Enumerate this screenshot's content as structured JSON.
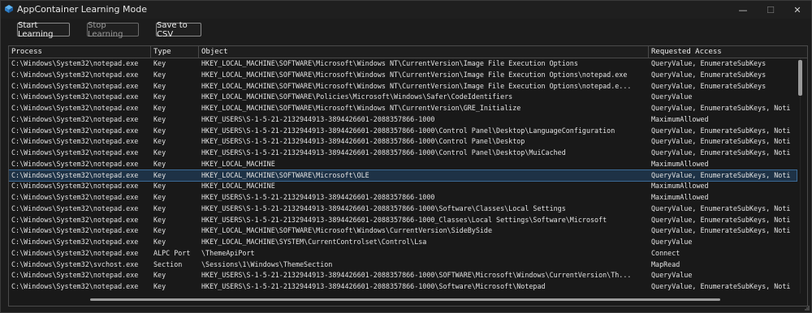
{
  "window": {
    "title": "AppContainer Learning Mode",
    "controls": {
      "minimize": "—",
      "maximize": "☐",
      "close": "✕"
    }
  },
  "toolbar": {
    "start": "Start Learning",
    "stop": "Stop Learning",
    "save": "Save to CSV"
  },
  "grid": {
    "columns": [
      "Process",
      "Type",
      "Object",
      "Requested Access"
    ],
    "rows": [
      [
        "C:\\Windows\\System32\\notepad.exe",
        "Key",
        "HKEY_LOCAL_MACHINE\\SOFTWARE\\Microsoft\\Windows NT\\CurrentVersion\\Image File Execution Options",
        "QueryValue, EnumerateSubKeys"
      ],
      [
        "C:\\Windows\\System32\\notepad.exe",
        "Key",
        "HKEY_LOCAL_MACHINE\\SOFTWARE\\Microsoft\\Windows NT\\CurrentVersion\\Image File Execution Options\\notepad.exe",
        "QueryValue, EnumerateSubKeys"
      ],
      [
        "C:\\Windows\\System32\\notepad.exe",
        "Key",
        "HKEY_LOCAL_MACHINE\\SOFTWARE\\Microsoft\\Windows NT\\CurrentVersion\\Image File Execution Options\\notepad.e...",
        "QueryValue, EnumerateSubKeys"
      ],
      [
        "C:\\Windows\\System32\\notepad.exe",
        "Key",
        "HKEY_LOCAL_MACHINE\\SOFTWARE\\Policies\\Microsoft\\Windows\\Safer\\CodeIdentifiers",
        "QueryValue"
      ],
      [
        "C:\\Windows\\System32\\notepad.exe",
        "Key",
        "HKEY_LOCAL_MACHINE\\SOFTWARE\\Microsoft\\Windows NT\\CurrentVersion\\GRE_Initialize",
        "QueryValue, EnumerateSubKeys, Noti"
      ],
      [
        "C:\\Windows\\System32\\notepad.exe",
        "Key",
        "HKEY_USERS\\S-1-5-21-2132944913-3894426601-2088357866-1000",
        "MaximumAllowed"
      ],
      [
        "C:\\Windows\\System32\\notepad.exe",
        "Key",
        "HKEY_USERS\\S-1-5-21-2132944913-3894426601-2088357866-1000\\Control Panel\\Desktop\\LanguageConfiguration",
        "QueryValue, EnumerateSubKeys, Noti"
      ],
      [
        "C:\\Windows\\System32\\notepad.exe",
        "Key",
        "HKEY_USERS\\S-1-5-21-2132944913-3894426601-2088357866-1000\\Control Panel\\Desktop",
        "QueryValue, EnumerateSubKeys, Noti"
      ],
      [
        "C:\\Windows\\System32\\notepad.exe",
        "Key",
        "HKEY_USERS\\S-1-5-21-2132944913-3894426601-2088357866-1000\\Control Panel\\Desktop\\MuiCached",
        "QueryValue, EnumerateSubKeys, Noti"
      ],
      [
        "C:\\Windows\\System32\\notepad.exe",
        "Key",
        "HKEY_LOCAL_MACHINE",
        "MaximumAllowed"
      ],
      [
        "C:\\Windows\\System32\\notepad.exe",
        "Key",
        "HKEY_LOCAL_MACHINE\\SOFTWARE\\Microsoft\\OLE",
        "QueryValue, EnumerateSubKeys, Noti"
      ],
      [
        "C:\\Windows\\System32\\notepad.exe",
        "Key",
        "HKEY_LOCAL_MACHINE",
        "MaximumAllowed"
      ],
      [
        "C:\\Windows\\System32\\notepad.exe",
        "Key",
        "HKEY_USERS\\S-1-5-21-2132944913-3894426601-2088357866-1000",
        "MaximumAllowed"
      ],
      [
        "C:\\Windows\\System32\\notepad.exe",
        "Key",
        "HKEY_USERS\\S-1-5-21-2132944913-3894426601-2088357866-1000\\Software\\Classes\\Local Settings",
        "QueryValue, EnumerateSubKeys, Noti"
      ],
      [
        "C:\\Windows\\System32\\notepad.exe",
        "Key",
        "HKEY_USERS\\S-1-5-21-2132944913-3894426601-2088357866-1000_Classes\\Local Settings\\Software\\Microsoft",
        "QueryValue, EnumerateSubKeys, Noti"
      ],
      [
        "C:\\Windows\\System32\\notepad.exe",
        "Key",
        "HKEY_LOCAL_MACHINE\\SOFTWARE\\Microsoft\\Windows\\CurrentVersion\\SideBySide",
        "QueryValue, EnumerateSubKeys, Noti"
      ],
      [
        "C:\\Windows\\System32\\notepad.exe",
        "Key",
        "HKEY_LOCAL_MACHINE\\SYSTEM\\CurrentControlset\\Control\\Lsa",
        "QueryValue"
      ],
      [
        "C:\\Windows\\System32\\notepad.exe",
        "ALPC Port",
        "\\ThemeApiPort",
        "Connect"
      ],
      [
        "C:\\Windows\\System32\\svchost.exe",
        "Section",
        "\\Sessions\\1\\Windows\\ThemeSection",
        "MapRead"
      ],
      [
        "C:\\Windows\\System32\\notepad.exe",
        "Key",
        "HKEY_USERS\\S-1-5-21-2132944913-3894426601-2088357866-1000\\SOFTWARE\\Microsoft\\Windows\\CurrentVersion\\Th...",
        "QueryValue"
      ],
      [
        "C:\\Windows\\System32\\notepad.exe",
        "Key",
        "HKEY_USERS\\S-1-5-21-2132944913-3894426601-2088357866-1000\\Software\\Microsoft\\Notepad",
        "QueryValue, EnumerateSubKeys, Noti"
      ]
    ],
    "selected_row": 10
  },
  "colors": {
    "background": "#1c1c1c",
    "selection": "#1e3246",
    "text": "#e2e2e2"
  },
  "icons": {
    "app": "app-window-icon",
    "minimize": "minimize-icon",
    "maximize": "maximize-icon",
    "close": "close-icon"
  }
}
